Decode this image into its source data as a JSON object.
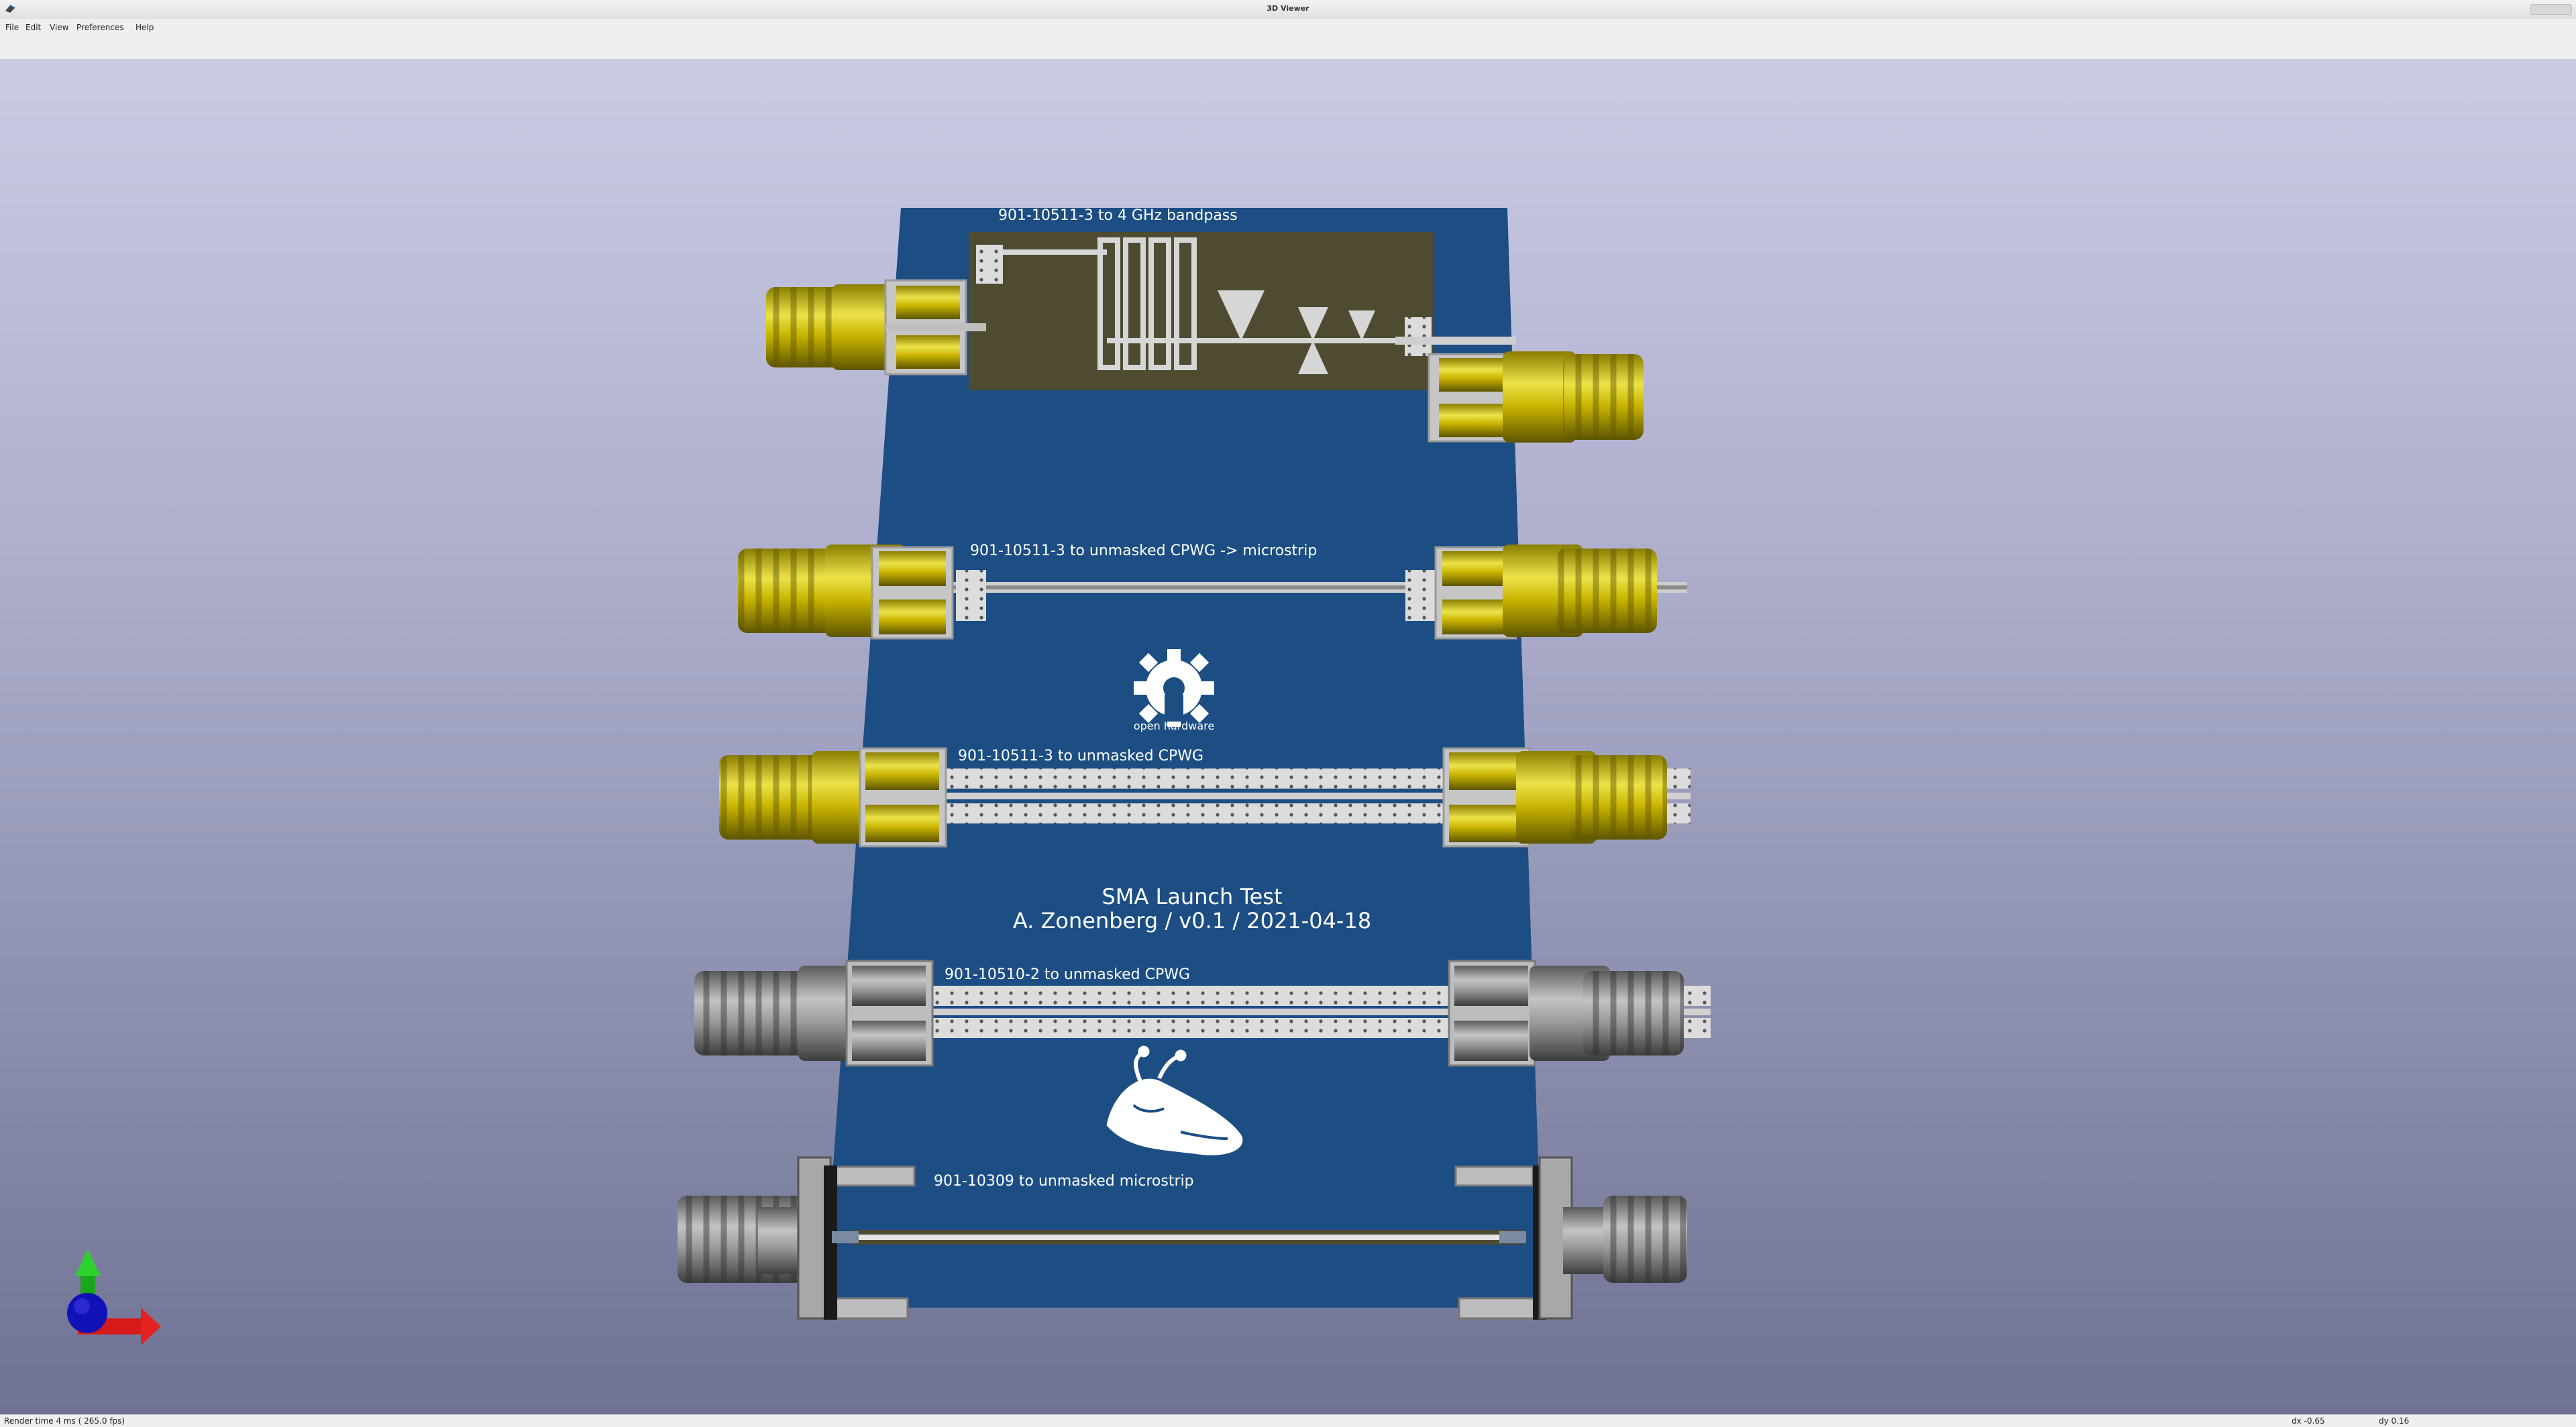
{
  "window": {
    "title": "3D Viewer"
  },
  "menu": [
    "File",
    "Edit",
    "View",
    "Preferences",
    "Help"
  ],
  "board": {
    "labels": {
      "bandpass": "901-10511-3 to 4 GHz bandpass",
      "cpwg_microstrip": "901-10511-3 to unmasked CPWG -> microstrip",
      "oshw": "open hardware",
      "cpwg1": "901-10511-3 to unmasked CPWG",
      "title_line1": "SMA Launch Test",
      "title_line2": "A. Zonenberg / v0.1 / 2021-04-18",
      "cpwg2": "901-10510-2 to unmasked CPWG",
      "microstrip": "901-10309 to unmasked microstrip"
    },
    "colors": {
      "board": "#1c4e84",
      "gold": "#c9b400",
      "silver": "#8c8c8c",
      "copper": "#4e4b31"
    }
  },
  "status": {
    "render_time": "Render time 4 ms ( 265.0 fps)",
    "dx": "dx -0.65",
    "dy": "dy 0.16"
  }
}
